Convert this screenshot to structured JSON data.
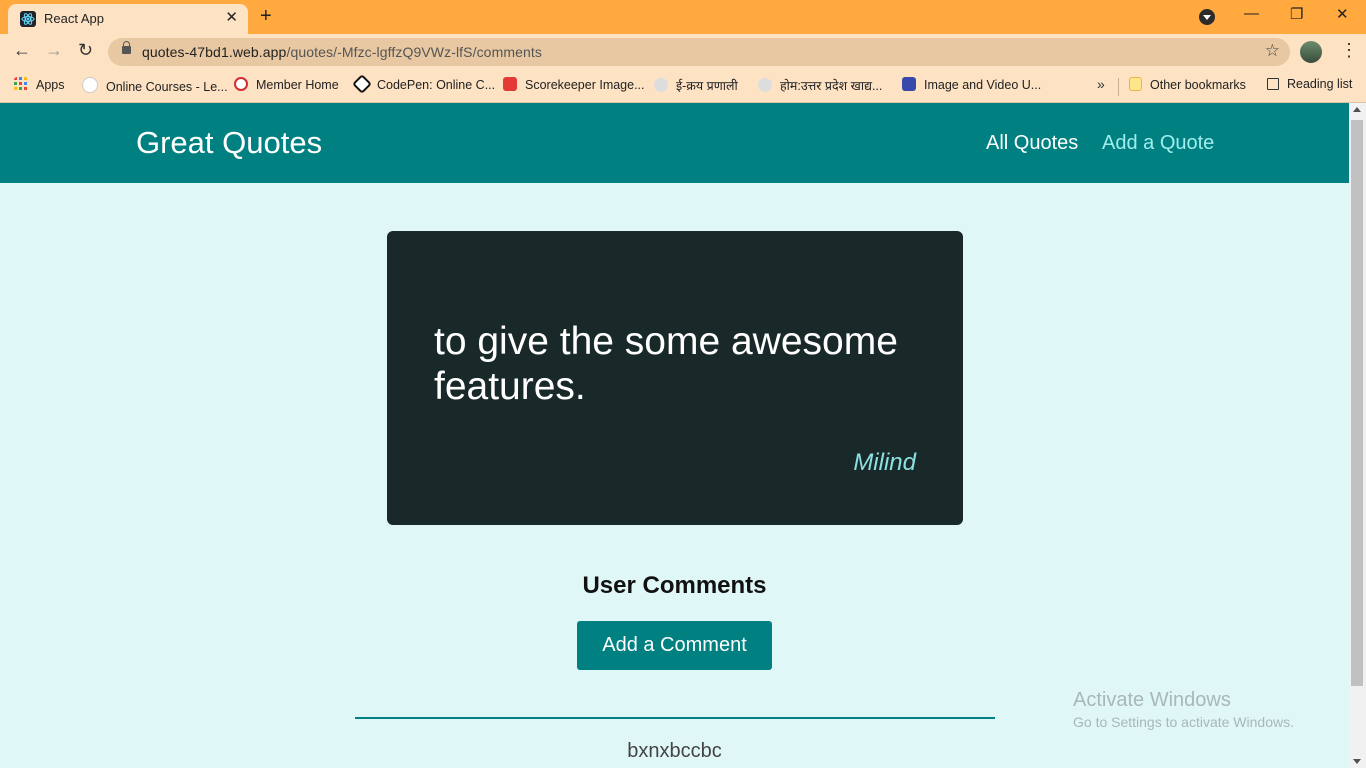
{
  "browser": {
    "tab": {
      "title": "React App",
      "close": "✕",
      "new_tab": "+",
      "favicon": "react-icon"
    },
    "window": {
      "minimize": "—",
      "restore": "❐",
      "close": "✕"
    },
    "toolbar": {
      "back": "←",
      "forward": "→",
      "reload": "↻",
      "url_host": "quotes-47bd1.web.app",
      "url_path": "/quotes/-Mfzc-lgffzQ9VWz-lfS/comments",
      "star": "☆",
      "menu": "⋮"
    },
    "bookmarks": {
      "items": [
        {
          "label": "Apps",
          "icon": "apps-grid-icon"
        },
        {
          "label": "Online Courses - Le...",
          "icon": "udemy-icon"
        },
        {
          "label": "Member Home",
          "icon": "member-home-icon"
        },
        {
          "label": "CodePen: Online C...",
          "icon": "codepen-icon"
        },
        {
          "label": "Scorekeeper Image...",
          "icon": "scorekeeper-icon"
        },
        {
          "label": "ई-क्रय प्रणाली",
          "icon": "up-govt-emblem-icon"
        },
        {
          "label": "होम:उत्तर प्रदेश खाद्य...",
          "icon": "up-govt-emblem-icon"
        },
        {
          "label": "Image and Video U...",
          "icon": "image-upload-icon"
        }
      ],
      "more": "»",
      "other": "Other bookmarks",
      "reading_list": "Reading list"
    }
  },
  "app": {
    "brand": "Great Quotes",
    "nav": {
      "all_quotes": "All Quotes",
      "add_quote": "Add a Quote"
    },
    "quote": {
      "text": "to give the some awesome features.",
      "author": "Milind"
    },
    "comments": {
      "title": "User Comments",
      "add_button": "Add a Comment",
      "items": [
        "bxnxbccbc"
      ]
    }
  },
  "watermark": {
    "title": "Activate Windows",
    "subtitle": "Go to Settings to activate Windows."
  },
  "colors": {
    "header": "#008080",
    "page_bg": "#e0f7f7",
    "card_bg": "#192929",
    "author": "#8ce0e0",
    "tab_strip": "#ffa93f"
  }
}
